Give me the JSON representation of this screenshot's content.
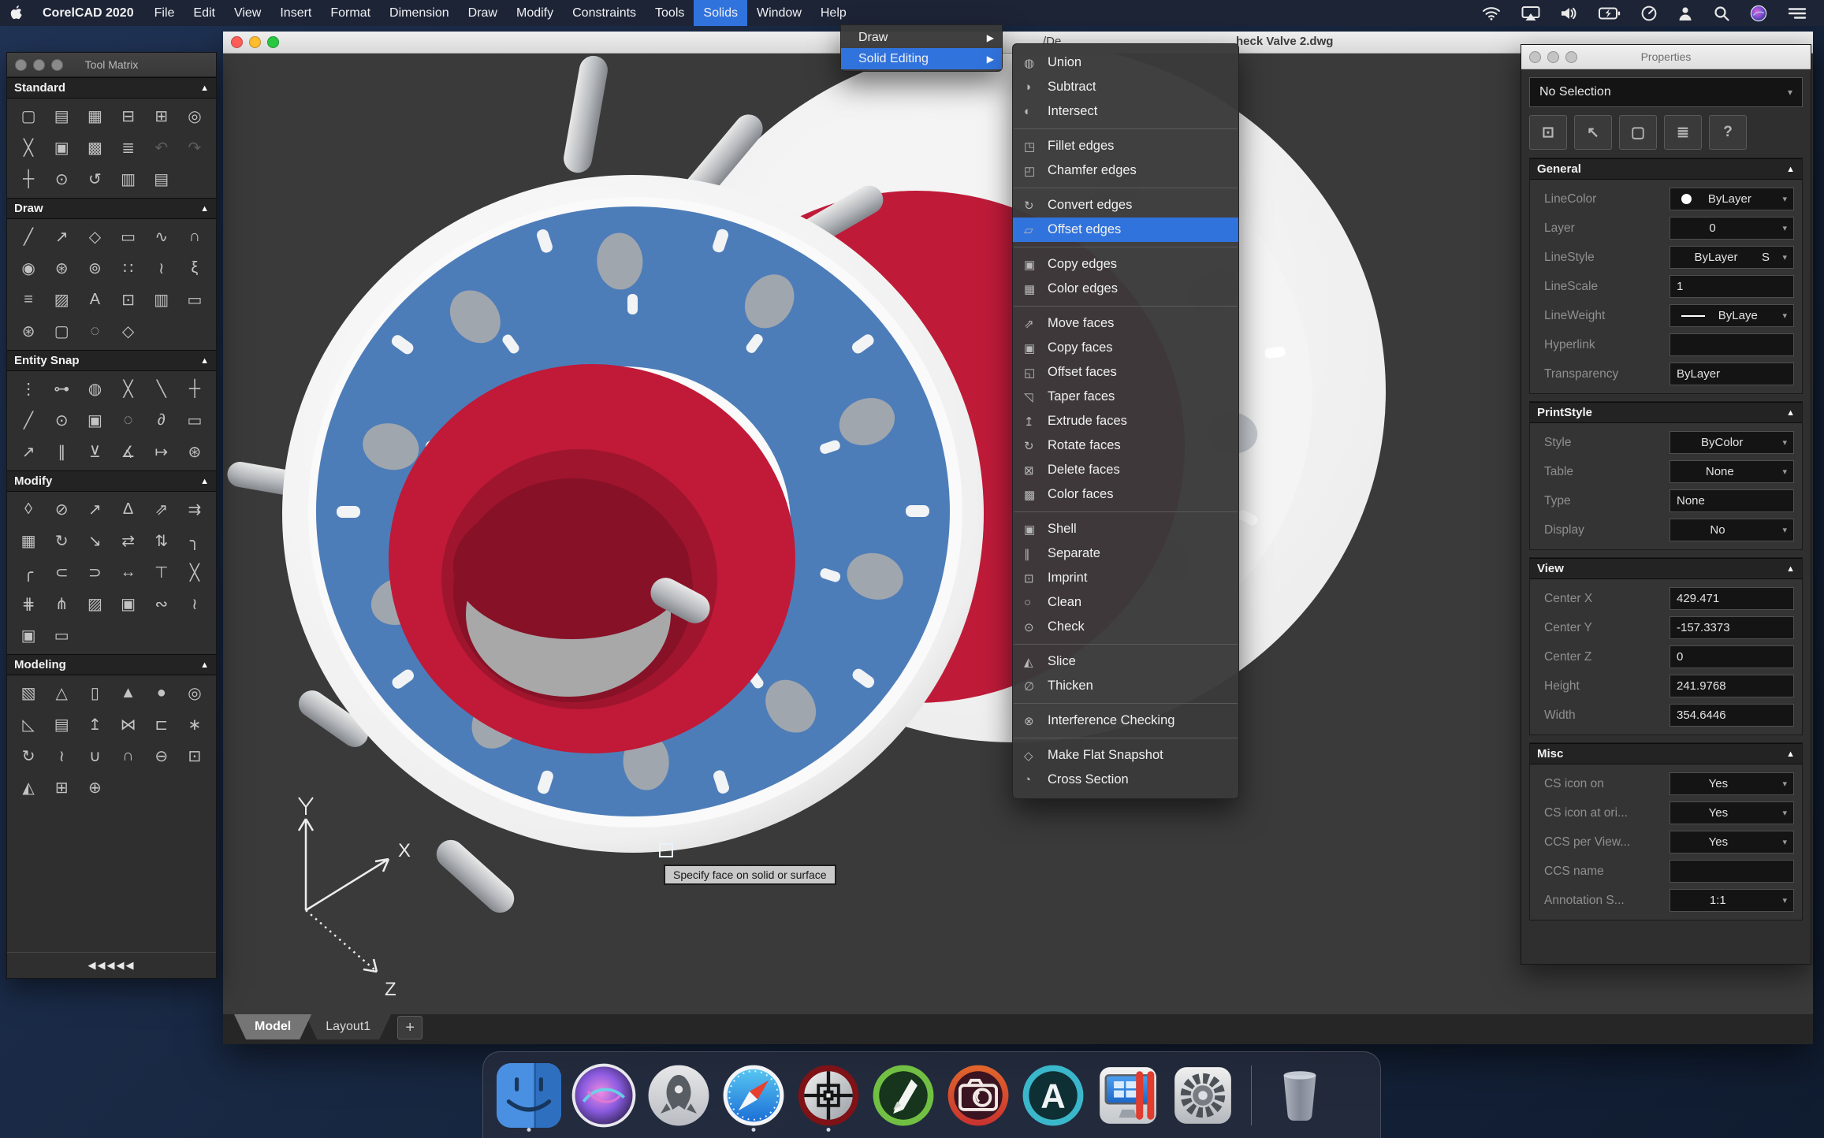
{
  "colors": {
    "accent_blue": "#3173dd",
    "canvas_gray": "#3a3a3a",
    "model_blue": "#4d7db9",
    "model_red": "#c01a38",
    "menubar": "#1d2436"
  },
  "menu_bar": {
    "app_name": "CorelCAD 2020",
    "items": [
      {
        "label": "File"
      },
      {
        "label": "Edit"
      },
      {
        "label": "View"
      },
      {
        "label": "Insert"
      },
      {
        "label": "Format"
      },
      {
        "label": "Dimension"
      },
      {
        "label": "Draw"
      },
      {
        "label": "Modify"
      },
      {
        "label": "Constraints"
      },
      {
        "label": "Tools"
      },
      {
        "label": "Solids",
        "active": true
      },
      {
        "label": "Window"
      },
      {
        "label": "Help"
      }
    ],
    "status_icons": [
      "wifi",
      "airplay-display",
      "volume",
      "battery",
      "clock",
      "user",
      "spotlight-search",
      "siri",
      "control-center-list"
    ]
  },
  "window": {
    "title_fragment_left": "/De",
    "title_fragment_right": "heck Valve 2.dwg",
    "tabs": [
      {
        "label": "Model",
        "active": true
      },
      {
        "label": "Layout1"
      }
    ],
    "new_tab_label": "+"
  },
  "solids_menu": {
    "items": [
      {
        "label": "Draw",
        "arrow": "▶"
      },
      {
        "label": "Solid Editing",
        "arrow": "▶",
        "active": true
      }
    ]
  },
  "solid_editing_menu": {
    "items": [
      {
        "name": "union",
        "icon": "◍",
        "label": "Union"
      },
      {
        "name": "subtract",
        "icon": "◑",
        "label": "Subtract"
      },
      {
        "name": "intersect",
        "icon": "◐",
        "label": "Intersect"
      },
      {
        "sep": true
      },
      {
        "name": "fillet-edges",
        "icon": "◳",
        "label": "Fillet edges"
      },
      {
        "name": "chamfer-edges",
        "icon": "◰",
        "label": "Chamfer edges"
      },
      {
        "sep": true
      },
      {
        "name": "convert-edges",
        "icon": "↻",
        "label": "Convert edges"
      },
      {
        "name": "offset-edges",
        "icon": "▱",
        "label": "Offset edges",
        "active": true
      },
      {
        "sep": true
      },
      {
        "name": "copy-edges",
        "icon": "▣",
        "label": "Copy edges"
      },
      {
        "name": "color-edges",
        "icon": "▦",
        "label": "Color edges"
      },
      {
        "sep": true
      },
      {
        "name": "move-faces",
        "icon": "⇗",
        "label": "Move faces"
      },
      {
        "name": "copy-faces",
        "icon": "▣",
        "label": "Copy faces"
      },
      {
        "name": "offset-faces",
        "icon": "◱",
        "label": "Offset faces"
      },
      {
        "name": "taper-faces",
        "icon": "◹",
        "label": "Taper faces"
      },
      {
        "name": "extrude-faces",
        "icon": "↥",
        "label": "Extrude faces"
      },
      {
        "name": "rotate-faces",
        "icon": "↻",
        "label": "Rotate faces"
      },
      {
        "name": "delete-faces",
        "icon": "⊠",
        "label": "Delete faces"
      },
      {
        "name": "color-faces",
        "icon": "▩",
        "label": "Color faces"
      },
      {
        "sep": true
      },
      {
        "name": "shell",
        "icon": "▣",
        "label": "Shell"
      },
      {
        "name": "separate",
        "icon": "∥",
        "label": "Separate"
      },
      {
        "name": "imprint",
        "icon": "⊡",
        "label": "Imprint"
      },
      {
        "name": "clean",
        "icon": "○",
        "label": "Clean"
      },
      {
        "name": "check",
        "icon": "⊙",
        "label": "Check"
      },
      {
        "sep": true
      },
      {
        "name": "slice",
        "icon": "◭",
        "label": "Slice"
      },
      {
        "name": "thicken",
        "icon": "∅",
        "label": "Thicken"
      },
      {
        "sep": true
      },
      {
        "name": "interference-checking",
        "icon": "⊗",
        "label": "Interference Checking"
      },
      {
        "sep": true
      },
      {
        "name": "make-flat-snapshot",
        "icon": "◇",
        "label": "Make Flat Snapshot"
      },
      {
        "name": "cross-section",
        "icon": "◔",
        "label": "Cross Section"
      }
    ]
  },
  "tool_matrix": {
    "title": "Tool Matrix",
    "collapse_label": "◀◀◀◀◀",
    "sections": [
      {
        "title": "Standard",
        "tools": [
          {
            "name": "new-drawing",
            "glyph": "▢"
          },
          {
            "name": "open",
            "glyph": "▤"
          },
          {
            "name": "save",
            "glyph": "▦"
          },
          {
            "name": "print",
            "glyph": "⊟"
          },
          {
            "name": "batch-print",
            "glyph": "⊞"
          },
          {
            "name": "print-preview",
            "glyph": "◎"
          },
          {
            "name": "cut",
            "glyph": "╳"
          },
          {
            "name": "copy",
            "glyph": "▣"
          },
          {
            "name": "paste",
            "glyph": "▩"
          },
          {
            "name": "property-painter",
            "glyph": "≣"
          },
          {
            "name": "undo",
            "glyph": "↶",
            "dim": true
          },
          {
            "name": "redo",
            "glyph": "↷",
            "dim": true
          },
          {
            "name": "pan",
            "glyph": "┼"
          },
          {
            "name": "zoom-dynamic",
            "glyph": "⊙"
          },
          {
            "name": "zoom-previous",
            "glyph": "↺"
          },
          {
            "name": "annotation-styles",
            "glyph": "▥"
          },
          {
            "name": "reference-open",
            "glyph": "▤"
          }
        ]
      },
      {
        "title": "Draw",
        "tools": [
          {
            "name": "line",
            "glyph": "╱"
          },
          {
            "name": "smart-line",
            "glyph": "↗"
          },
          {
            "name": "polygon",
            "glyph": "◇"
          },
          {
            "name": "rectangle",
            "glyph": "▭"
          },
          {
            "name": "spline",
            "glyph": "∿"
          },
          {
            "name": "arc",
            "glyph": "∩"
          },
          {
            "name": "circle",
            "glyph": "◉"
          },
          {
            "name": "ellipse",
            "glyph": "⊛"
          },
          {
            "name": "elliptical-arc",
            "glyph": "⊚"
          },
          {
            "name": "point",
            "glyph": "∷"
          },
          {
            "name": "freehand",
            "glyph": "≀"
          },
          {
            "name": "sketch",
            "glyph": "ξ"
          },
          {
            "name": "multiline",
            "glyph": "≡"
          },
          {
            "name": "hatch",
            "glyph": "▨"
          },
          {
            "name": "text",
            "glyph": "A"
          },
          {
            "name": "region",
            "glyph": "⊡"
          },
          {
            "name": "table",
            "glyph": "▥"
          },
          {
            "name": "text-block",
            "glyph": "▭"
          },
          {
            "name": "selection-settings",
            "glyph": "⊛"
          },
          {
            "name": "selection-window",
            "glyph": "▢"
          },
          {
            "name": "revision-cloud",
            "glyph": "◌"
          },
          {
            "name": "freeform-shape",
            "glyph": "◇"
          }
        ]
      },
      {
        "title": "Entity Snap",
        "tools": [
          {
            "name": "snap-settings",
            "glyph": "⋮"
          },
          {
            "name": "snap-endpoint",
            "glyph": "⊶"
          },
          {
            "name": "snap-midpoint",
            "glyph": "◍"
          },
          {
            "name": "snap-intersection",
            "glyph": "╳"
          },
          {
            "name": "snap-nearest",
            "glyph": "╲"
          },
          {
            "name": "snap-cross",
            "glyph": "┼"
          },
          {
            "name": "snap-point",
            "glyph": "╱"
          },
          {
            "name": "snap-center",
            "glyph": "⊙"
          },
          {
            "name": "snap-node",
            "glyph": "▣"
          },
          {
            "name": "snap-quadrant",
            "glyph": "◌"
          },
          {
            "name": "snap-tangent",
            "glyph": "∂"
          },
          {
            "name": "snap-insertion",
            "glyph": "▭"
          },
          {
            "name": "snap-extension",
            "glyph": "↗"
          },
          {
            "name": "snap-parallel",
            "glyph": "∥"
          },
          {
            "name": "snap-perpendicular",
            "glyph": "⊻"
          },
          {
            "name": "snap-apparent",
            "glyph": "∡"
          },
          {
            "name": "snap-from",
            "glyph": "↦"
          },
          {
            "name": "snap-gear",
            "glyph": "⊛"
          }
        ]
      },
      {
        "title": "Modify",
        "tools": [
          {
            "name": "erase",
            "glyph": "◊"
          },
          {
            "name": "delete-duplicates",
            "glyph": "⊘"
          },
          {
            "name": "move",
            "glyph": "↗"
          },
          {
            "name": "mirror",
            "glyph": "Δ"
          },
          {
            "name": "copy-move",
            "glyph": "⇗"
          },
          {
            "name": "stretch",
            "glyph": "⇉"
          },
          {
            "name": "pattern",
            "glyph": "▦"
          },
          {
            "name": "rotate",
            "glyph": "↻"
          },
          {
            "name": "scale",
            "glyph": "↘"
          },
          {
            "name": "align",
            "glyph": "⇄"
          },
          {
            "name": "reorder",
            "glyph": "⇅"
          },
          {
            "name": "fillet",
            "glyph": "╮"
          },
          {
            "name": "chamfer",
            "glyph": "╭"
          },
          {
            "name": "blend-curve",
            "glyph": "⊂"
          },
          {
            "name": "close-curve",
            "glyph": "⊃"
          },
          {
            "name": "join",
            "glyph": "↔"
          },
          {
            "name": "extend",
            "glyph": "⊤"
          },
          {
            "name": "trim",
            "glyph": "╳"
          },
          {
            "name": "power-trim",
            "glyph": "⋕"
          },
          {
            "name": "split",
            "glyph": "⋔"
          },
          {
            "name": "edit-hatch",
            "glyph": "▨"
          },
          {
            "name": "overlap",
            "glyph": "▣"
          },
          {
            "name": "edit-spline",
            "glyph": "∾"
          },
          {
            "name": "edit-curve",
            "glyph": "≀"
          },
          {
            "name": "edit-polyline",
            "glyph": "▣"
          },
          {
            "name": "edit-annotation",
            "glyph": "▭"
          }
        ]
      },
      {
        "title": "Modeling",
        "tools": [
          {
            "name": "box",
            "glyph": "▧"
          },
          {
            "name": "cone",
            "glyph": "△"
          },
          {
            "name": "cylinder",
            "glyph": "▯"
          },
          {
            "name": "pyramid",
            "glyph": "▲"
          },
          {
            "name": "sphere",
            "glyph": "●"
          },
          {
            "name": "torus",
            "glyph": "◎"
          },
          {
            "name": "wedge",
            "glyph": "◺"
          },
          {
            "name": "slab",
            "glyph": "▤"
          },
          {
            "name": "extrude",
            "glyph": "↥"
          },
          {
            "name": "loft",
            "glyph": "⋈"
          },
          {
            "name": "rib",
            "glyph": "⊏"
          },
          {
            "name": "convert",
            "glyph": "∗"
          },
          {
            "name": "revolve",
            "glyph": "↻"
          },
          {
            "name": "sweep",
            "glyph": "≀"
          },
          {
            "name": "solid-union",
            "glyph": "∪"
          },
          {
            "name": "solid-intersect",
            "glyph": "∩"
          },
          {
            "name": "solid-subtract",
            "glyph": "⊖"
          },
          {
            "name": "extract-edges",
            "glyph": "⊡"
          },
          {
            "name": "slice-solid",
            "glyph": "◭"
          },
          {
            "name": "interference",
            "glyph": "⊞"
          },
          {
            "name": "check-solid",
            "glyph": "⊕"
          }
        ]
      }
    ]
  },
  "properties": {
    "title": "Properties",
    "selector_value": "No Selection",
    "toolbar": [
      {
        "name": "select-matching",
        "glyph": "⊡"
      },
      {
        "name": "select-cursor",
        "glyph": "↖"
      },
      {
        "name": "select-window",
        "glyph": "▢"
      },
      {
        "name": "quick-select",
        "glyph": "≣"
      },
      {
        "name": "help",
        "glyph": "?"
      }
    ],
    "sections": [
      {
        "title": "General",
        "rows": [
          {
            "label": "LineColor",
            "value": "ByLayer",
            "dd": true,
            "swatch_dot": true
          },
          {
            "label": "Layer",
            "value": "0",
            "dd": true
          },
          {
            "label": "LineStyle",
            "value": "ByLayer",
            "suffix": "S",
            "dd": true
          },
          {
            "label": "LineScale",
            "value": "1"
          },
          {
            "label": "LineWeight",
            "value": "ByLaye",
            "dd": true,
            "swatch_line": true
          },
          {
            "label": "Hyperlink",
            "value": ""
          },
          {
            "label": "Transparency",
            "value": "ByLayer"
          }
        ]
      },
      {
        "title": "PrintStyle",
        "rows": [
          {
            "label": "Style",
            "value": "ByColor",
            "dd": true
          },
          {
            "label": "Table",
            "value": "None",
            "dd": true
          },
          {
            "label": "Type",
            "value": "None"
          },
          {
            "label": "Display",
            "value": "No",
            "dd": true
          }
        ]
      },
      {
        "title": "View",
        "rows": [
          {
            "label": "Center X",
            "value": "429.471"
          },
          {
            "label": "Center Y",
            "value": "-157.3373"
          },
          {
            "label": "Center Z",
            "value": "0"
          },
          {
            "label": "Height",
            "value": "241.9768"
          },
          {
            "label": "Width",
            "value": "354.6446"
          }
        ]
      },
      {
        "title": "Misc",
        "rows": [
          {
            "label": "CS icon on",
            "value": "Yes",
            "dd": true
          },
          {
            "label": "CS icon at ori...",
            "value": "Yes",
            "dd": true
          },
          {
            "label": "CCS per View...",
            "value": "Yes",
            "dd": true
          },
          {
            "label": "CCS name",
            "value": ""
          },
          {
            "label": "Annotation S...",
            "value": "1:1",
            "dd": true
          }
        ]
      }
    ]
  },
  "canvas": {
    "tooltip": "Specify face on solid or surface",
    "axis_labels": {
      "x": "X",
      "y": "Y",
      "z": "Z"
    }
  },
  "dock": {
    "items": [
      "finder",
      "siri",
      "launchpad",
      "safari",
      "corelcad",
      "coreldraw",
      "photo-paint",
      "font-manager",
      "parallels",
      "system-preferences",
      "trash"
    ],
    "running": [
      "finder",
      "safari",
      "corelcad"
    ]
  }
}
